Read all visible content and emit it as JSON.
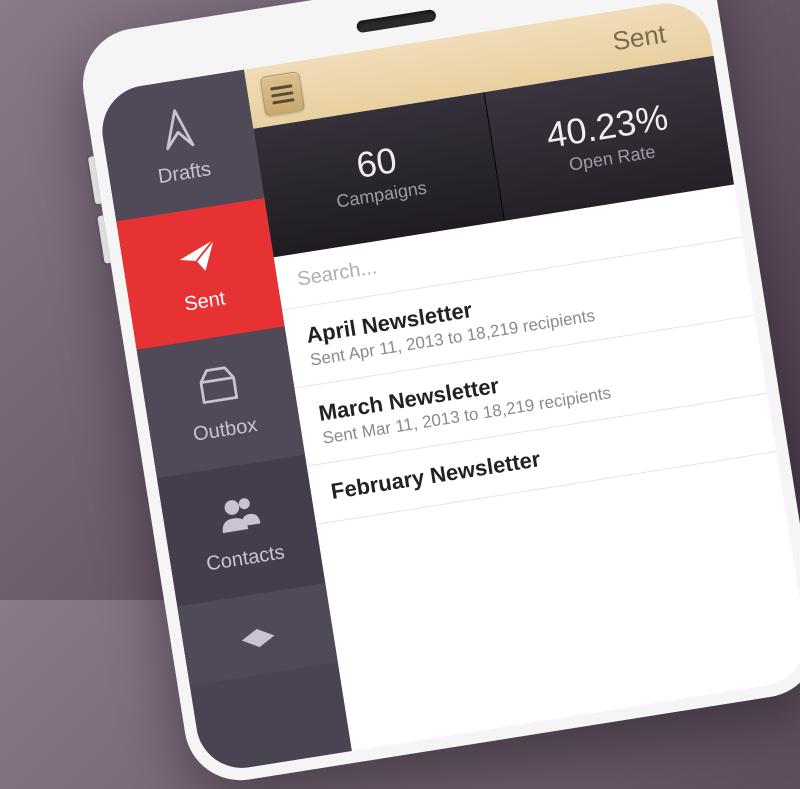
{
  "sidebar": {
    "items": [
      {
        "label": "Drafts",
        "icon": "drafts-icon",
        "active": false
      },
      {
        "label": "Sent",
        "icon": "paper-plane-icon",
        "active": true
      },
      {
        "label": "Outbox",
        "icon": "outbox-icon",
        "active": false
      },
      {
        "label": "Contacts",
        "icon": "contacts-icon",
        "active": false
      }
    ]
  },
  "header": {
    "title": "Sent"
  },
  "stats": [
    {
      "value": "60",
      "label": "Campaigns"
    },
    {
      "value": "40.23%",
      "label": "Open Rate"
    }
  ],
  "search": {
    "placeholder": "Search..."
  },
  "campaigns": [
    {
      "title": "April Newsletter",
      "subtitle": "Sent Apr 11, 2013 to 18,219 recipients"
    },
    {
      "title": "March Newsletter",
      "subtitle": "Sent Mar 11, 2013 to 18,219 recipients"
    },
    {
      "title": "February Newsletter",
      "subtitle": ""
    }
  ],
  "colors": {
    "accent": "#e63232",
    "sidebar": "#4a4452",
    "header": "#e8d0a0"
  }
}
